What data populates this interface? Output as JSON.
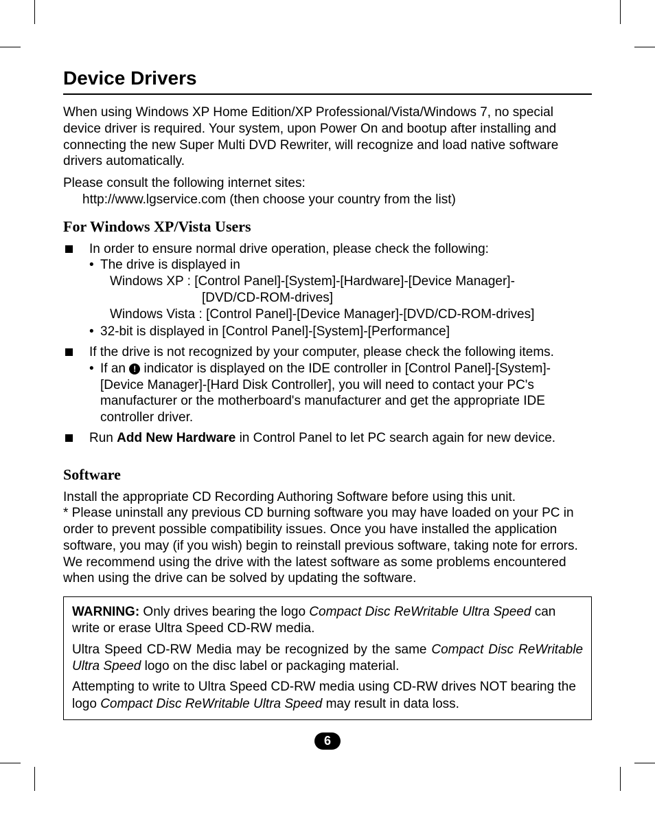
{
  "title": "Device Drivers",
  "intro": "When using Windows XP Home Edition/XP Professional/Vista/Windows 7, no special device driver is required. Your system, upon Power On and bootup after installing and connecting the new Super Multi DVD Rewriter, will recognize and load native software drivers automatically.",
  "consult_line": "Please consult the following internet sites:",
  "consult_url": "http://www.lgservice.com (then choose your country from the list)",
  "subhead_windows": "For Windows XP/Vista Users",
  "blk1_intro": "In order to ensure normal drive operation, please check the following:",
  "dot1_line1": "The drive is displayed in",
  "dot1_xp": "Windows XP : [Control Panel]-[System]-[Hardware]-[Device Manager]-",
  "dot1_xp_cont": "[DVD/CD-ROM-drives]",
  "dot1_vista": "Windows Vista : [Control Panel]-[Device Manager]-[DVD/CD-ROM-drives]",
  "dot2": "32-bit is displayed in [Control Panel]-[System]-[Performance]",
  "blk2_intro": "If the drive is not recognized by your computer, please check the following items.",
  "dot3_pre": "If an ",
  "dot3_post": " indicator is displayed on the IDE controller in [Control Panel]-[System]-[Device Manager]-[Hard Disk Controller], you will need to contact your PC's manufacturer or the motherboard's manufacturer and get the appropriate IDE controller driver.",
  "blk3_pre": "Run ",
  "blk3_bold": "Add New Hardware",
  "blk3_post": " in Control Panel to let PC search again for new device.",
  "subhead_software": "Software",
  "sw_line1": "Install the appropriate CD Recording Authoring Software before using this unit.",
  "sw_line2": "* Please uninstall any previous CD burning software you may have loaded on your PC in order to prevent possible compatibility issues. Once you have installed the application software, you may (if you wish) begin to reinstall previous software, taking note for errors.",
  "sw_line3": "We recommend using the drive with the latest software as some problems encountered when using the drive can be solved by updating the software.",
  "warn_bold": "WARNING:",
  "warn_p1_pre": " Only drives bearing the logo ",
  "warn_brand": "Compact Disc ReWritable Ultra Speed",
  "warn_p1_post": " can write or erase Ultra Speed CD-RW media.",
  "warn_p2_pre": "Ultra Speed CD-RW Media may be recognized by the same ",
  "warn_p2_post": " logo on the disc label or packaging material.",
  "warn_p3_pre": "Attempting to write to Ultra Speed CD-RW media using CD-RW drives NOT bearing the logo ",
  "warn_p3_post": " may result in data loss.",
  "page_number": "6",
  "warn_icon_glyph": "!"
}
